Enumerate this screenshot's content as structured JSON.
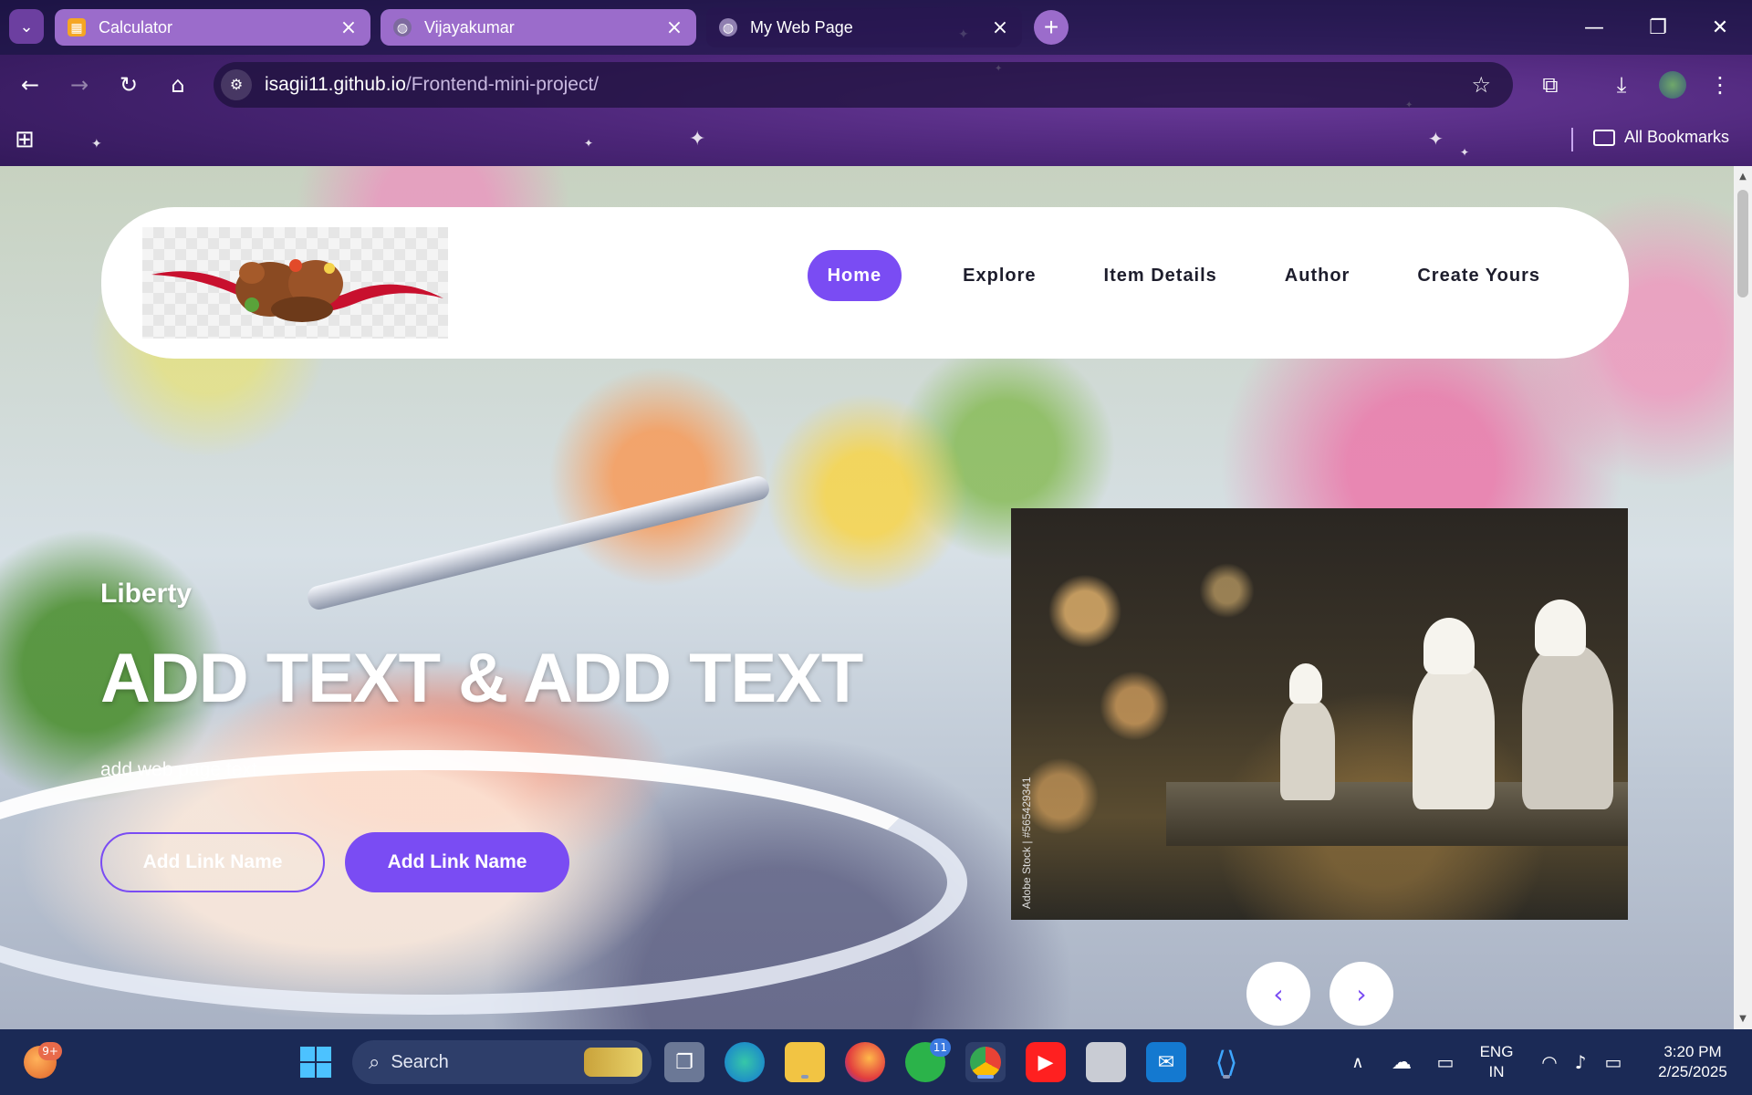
{
  "browser": {
    "tabs": [
      {
        "title": "Calculator",
        "favicon": "calculator-icon",
        "active": false
      },
      {
        "title": "Vijayakumar",
        "favicon": "globe-icon",
        "active": false
      },
      {
        "title": "My Web Page",
        "favicon": "globe-icon",
        "active": true
      }
    ],
    "address": {
      "host": "isagii11.github.io",
      "path": "/Frontend-mini-project/"
    },
    "bookmarks_label": "All Bookmarks",
    "accent": "#4b2577"
  },
  "page": {
    "nav": {
      "items": [
        "Home",
        "Explore",
        "Item Details",
        "Author",
        "Create Yours"
      ],
      "active": "Home"
    },
    "hero": {
      "subtitle": "Liberty",
      "title": "ADD TEXT & ADD TEXT",
      "text": "add web page text",
      "button_outline": "Add Link Name",
      "button_fill": "Add Link Name"
    },
    "image_watermark": "Adobe Stock | #565429341",
    "carousel": {
      "prev": "‹",
      "next": "›"
    },
    "accent": "#7a4cf3"
  },
  "taskbar": {
    "search_placeholder": "Search",
    "notification_badge": "9+",
    "whatsapp_badge": "11",
    "language": "ENG",
    "region": "IN",
    "time": "3:20 PM",
    "date": "2/25/2025"
  }
}
